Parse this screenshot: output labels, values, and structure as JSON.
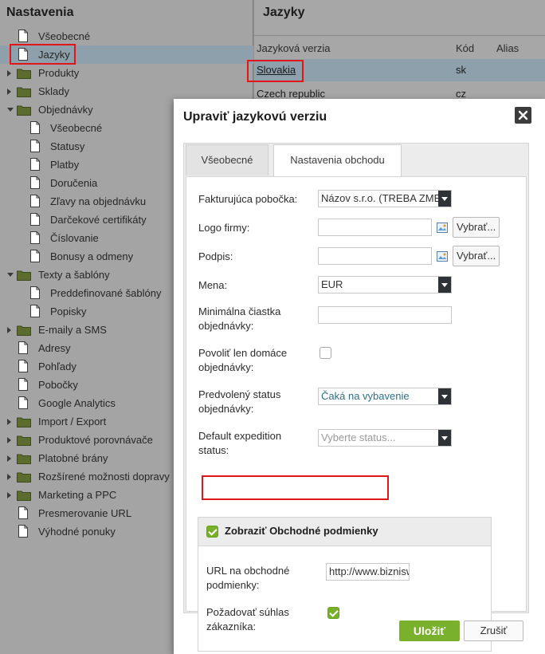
{
  "left": {
    "title": "Nastavenia",
    "items": [
      {
        "label": "Všeobecné",
        "icon": "document-icon",
        "indent": 0,
        "arrow": "none"
      },
      {
        "label": "Jazyky",
        "icon": "document-icon",
        "indent": 0,
        "arrow": "none",
        "selected": true
      },
      {
        "label": "Produkty",
        "icon": "folder-icon",
        "indent": 0,
        "arrow": "collapsed"
      },
      {
        "label": "Sklady",
        "icon": "folder-icon",
        "indent": 0,
        "arrow": "collapsed"
      },
      {
        "label": "Objednávky",
        "icon": "folder-icon",
        "indent": 0,
        "arrow": "expanded"
      },
      {
        "label": "Všeobecné",
        "icon": "document-icon",
        "indent": 1,
        "arrow": "none"
      },
      {
        "label": "Statusy",
        "icon": "document-icon",
        "indent": 1,
        "arrow": "none"
      },
      {
        "label": "Platby",
        "icon": "document-icon",
        "indent": 1,
        "arrow": "none"
      },
      {
        "label": "Doručenia",
        "icon": "document-icon",
        "indent": 1,
        "arrow": "none"
      },
      {
        "label": "Zľavy na objednávku",
        "icon": "document-icon",
        "indent": 1,
        "arrow": "none"
      },
      {
        "label": "Darčekové certifikáty",
        "icon": "document-icon",
        "indent": 1,
        "arrow": "none"
      },
      {
        "label": "Číslovanie",
        "icon": "document-icon",
        "indent": 1,
        "arrow": "none"
      },
      {
        "label": "Bonusy a odmeny",
        "icon": "document-icon",
        "indent": 1,
        "arrow": "none"
      },
      {
        "label": "Texty a šablóny",
        "icon": "folder-icon",
        "indent": 0,
        "arrow": "expanded"
      },
      {
        "label": "Preddefinované šablóny",
        "icon": "document-icon",
        "indent": 1,
        "arrow": "none"
      },
      {
        "label": "Popisky",
        "icon": "document-icon",
        "indent": 1,
        "arrow": "none"
      },
      {
        "label": "E-maily a SMS",
        "icon": "folder-icon",
        "indent": 0,
        "arrow": "collapsed"
      },
      {
        "label": "Adresy",
        "icon": "document-icon",
        "indent": 0,
        "arrow": "none"
      },
      {
        "label": "Pohľady",
        "icon": "document-icon",
        "indent": 0,
        "arrow": "none"
      },
      {
        "label": "Pobočky",
        "icon": "document-icon",
        "indent": 0,
        "arrow": "none"
      },
      {
        "label": "Google Analytics",
        "icon": "document-icon",
        "indent": 0,
        "arrow": "none"
      },
      {
        "label": "Import / Export",
        "icon": "folder-icon",
        "indent": 0,
        "arrow": "collapsed"
      },
      {
        "label": "Produktové porovnávače",
        "icon": "folder-icon",
        "indent": 0,
        "arrow": "collapsed"
      },
      {
        "label": "Platobné brány",
        "icon": "folder-icon",
        "indent": 0,
        "arrow": "collapsed"
      },
      {
        "label": "Rozšírené možnosti dopravy",
        "icon": "folder-icon",
        "indent": 0,
        "arrow": "collapsed"
      },
      {
        "label": "Marketing a PPC",
        "icon": "folder-icon",
        "indent": 0,
        "arrow": "collapsed"
      },
      {
        "label": "Presmerovanie URL",
        "icon": "document-icon",
        "indent": 0,
        "arrow": "none"
      },
      {
        "label": "Výhodné ponuky",
        "icon": "document-icon",
        "indent": 0,
        "arrow": "none"
      }
    ]
  },
  "right": {
    "title": "Jazyky",
    "columns": [
      "Jazyková verzia",
      "Kód",
      "Alias"
    ],
    "rows": [
      {
        "name": "Slovakia",
        "code": "sk",
        "selected": true
      },
      {
        "name": "Czech republic",
        "code": "cz"
      }
    ]
  },
  "modal": {
    "title": "Upraviť jazykovú verziu",
    "tabs": [
      "Všeobecné",
      "Nastavenia obchodu"
    ],
    "fields": {
      "branch_label": "Fakturujúca pobočka:",
      "branch_value": "Názov s.r.o. (TREBA ZMENIŤ)",
      "logo_label": "Logo firmy:",
      "logo_button": "Vybrať...",
      "signature_label": "Podpis:",
      "signature_button": "Vybrať...",
      "currency_label": "Mena:",
      "currency_value": "EUR",
      "min_amount_label_1": "Minimálna čiastka",
      "min_amount_label_2": "objednávky:",
      "domestic_label_1": "Povoliť len domáce",
      "domestic_label_2": "objednávky:",
      "status_label_1": "Predvolený status",
      "status_label_2": "objednávky:",
      "status_value": "Čaká na vybavenie",
      "expedition_label_1": "Default expedition",
      "expedition_label_2": "status:",
      "expedition_placeholder": "Vyberte status..."
    },
    "terms": {
      "header": "Zobraziť Obchodné podmienky",
      "url_label_1": "URL na obchodné",
      "url_label_2": "podmienky:",
      "url_value": "http://www.biznisweb.sk",
      "consent_label_1": "Požadovať súhlas",
      "consent_label_2": "zákazníka:"
    },
    "save_label": "Uložiť",
    "cancel_label": "Zrušiť"
  },
  "colors": {
    "highlight_box": "#e0161b",
    "accent_green": "#79b12c",
    "selection": "#8fa0ad"
  }
}
